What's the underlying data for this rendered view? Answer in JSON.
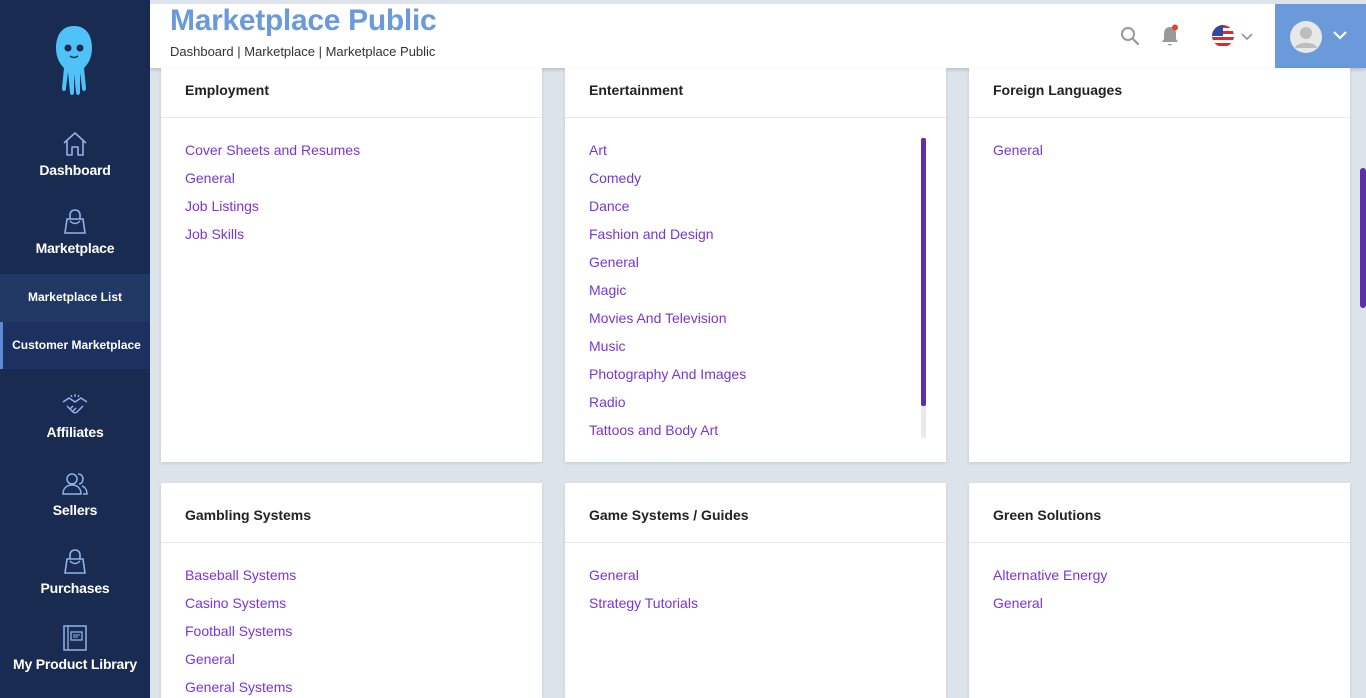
{
  "sidebar": {
    "nav": [
      {
        "label": "Dashboard",
        "icon": "home-icon"
      },
      {
        "label": "Marketplace",
        "icon": "shopping-bag-icon"
      },
      {
        "label": "Affiliates",
        "icon": "handshake-icon"
      },
      {
        "label": "Sellers",
        "icon": "users-icon"
      },
      {
        "label": "Purchases",
        "icon": "shopping-bag-icon"
      },
      {
        "label": "My Product Library",
        "icon": "book-icon"
      }
    ],
    "sub_nav": [
      {
        "label": "Marketplace List"
      },
      {
        "label": "Customer Marketplace",
        "active": true
      }
    ]
  },
  "header": {
    "title": "Marketplace Public",
    "breadcrumb": "Dashboard | Marketplace | Marketplace Public",
    "accent_color": "#6a9ad9"
  },
  "cards": [
    {
      "title": "Employment",
      "links": [
        "Cover Sheets and Resumes",
        "General",
        "Job Listings",
        "Job Skills"
      ]
    },
    {
      "title": "Entertainment",
      "links": [
        "Art",
        "Comedy",
        "Dance",
        "Fashion and Design",
        "General",
        "Magic",
        "Movies And Television",
        "Music",
        "Photography And Images",
        "Radio",
        "Tattoos and Body Art"
      ]
    },
    {
      "title": "Foreign Languages",
      "links": [
        "General"
      ]
    },
    {
      "title": "Gambling Systems",
      "links": [
        "Baseball Systems",
        "Casino Systems",
        "Football Systems",
        "General",
        "General Systems"
      ]
    },
    {
      "title": "Game Systems / Guides",
      "links": [
        "General",
        "Strategy Tutorials"
      ]
    },
    {
      "title": "Green Solutions",
      "links": [
        "Alternative Energy",
        "General"
      ]
    }
  ],
  "colors": {
    "sidebar_bg": "#1a2b52",
    "link": "#7a35d6",
    "scrollbar": "#5b2fa8"
  }
}
